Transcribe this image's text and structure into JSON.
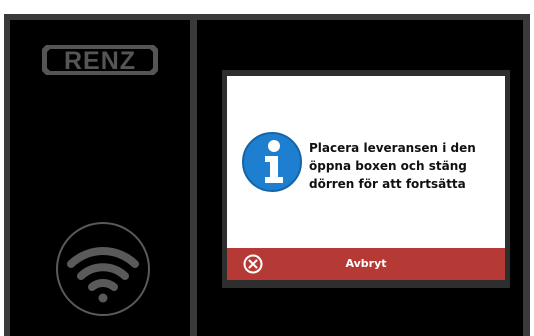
{
  "brand": {
    "logo_text": "RENZ"
  },
  "icons": {
    "logo": "renz-logo",
    "wifi": "wifi-icon",
    "info": "info-icon",
    "cancel": "cancel-circle-x-icon"
  },
  "dialog": {
    "message_lines": [
      "Placera leveransen i den",
      "öppna boxen och stäng",
      "dörren för att fortsätta"
    ],
    "cancel_label": "Avbryt"
  },
  "colors": {
    "background": "#000000",
    "divider": "#3a3a3a",
    "icon_gray": "#5a5a5a",
    "info_blue": "#1e7fd0",
    "cancel_red": "#b53a35"
  }
}
